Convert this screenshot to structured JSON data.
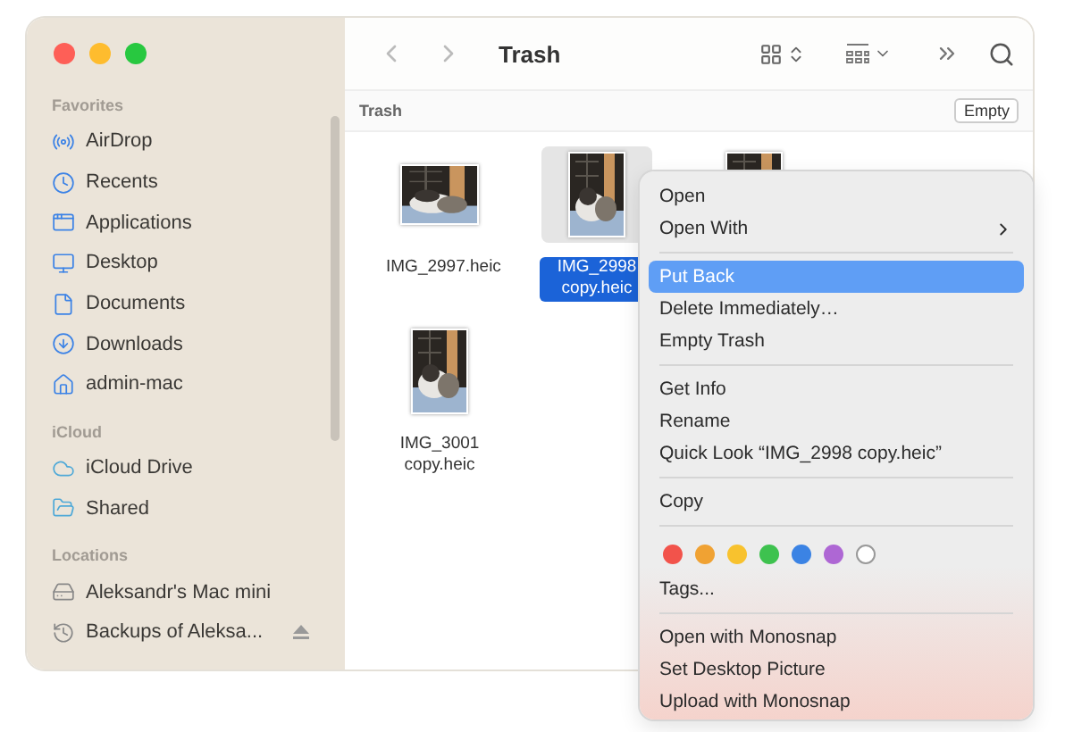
{
  "window": {
    "title": "Trash",
    "controls": [
      {
        "color": "#fe5f57"
      },
      {
        "color": "#febc2e"
      },
      {
        "color": "#28c840"
      }
    ]
  },
  "sidebar": {
    "sections": [
      {
        "heading": "Favorites",
        "items": [
          {
            "label": "AirDrop"
          },
          {
            "label": "Recents"
          },
          {
            "label": "Applications"
          },
          {
            "label": "Desktop"
          },
          {
            "label": "Documents"
          },
          {
            "label": "Downloads"
          },
          {
            "label": "admin-mac"
          }
        ]
      },
      {
        "heading": "iCloud",
        "items": [
          {
            "label": "iCloud Drive"
          },
          {
            "label": "Shared"
          }
        ]
      },
      {
        "heading": "Locations",
        "items": [
          {
            "label": "Aleksandr's Mac mini"
          },
          {
            "label": "Backups of Aleksa...",
            "eject": true
          }
        ]
      }
    ]
  },
  "path_bar": {
    "label": "Trash",
    "button": "Empty"
  },
  "files": [
    {
      "name": "IMG_2997.heic",
      "selected": false,
      "kind": "landscape"
    },
    {
      "name": "IMG_2998 copy.heic",
      "selected": true,
      "kind": "portrait"
    },
    {
      "selected": false,
      "kind": "portrait"
    },
    {
      "name": "IMG_3001 copy.heic",
      "selected": false,
      "kind": "portrait"
    }
  ],
  "context_menu": {
    "items": [
      {
        "kind": "item",
        "label": "Open",
        "selected": false
      },
      {
        "kind": "item",
        "label": "Open With",
        "selected": false,
        "submenu": true
      },
      {
        "kind": "separator"
      },
      {
        "kind": "item",
        "label": "Put Back",
        "selected": true
      },
      {
        "kind": "item",
        "label": "Delete Immediately…",
        "selected": false
      },
      {
        "kind": "item",
        "label": "Empty Trash",
        "selected": false
      },
      {
        "kind": "separator"
      },
      {
        "kind": "item",
        "label": "Get Info",
        "selected": false
      },
      {
        "kind": "item",
        "label": "Rename",
        "selected": false
      },
      {
        "kind": "item",
        "label": "Quick Look “IMG_2998 copy.heic”",
        "selected": false
      },
      {
        "kind": "separator"
      },
      {
        "kind": "item",
        "label": "Copy",
        "selected": false
      },
      {
        "kind": "separator"
      },
      {
        "kind": "tags",
        "colors": [
          {
            "color": "#f2534b"
          },
          {
            "color": "#f0a233"
          },
          {
            "color": "#f8c22e"
          },
          {
            "color": "#3ec24f"
          },
          {
            "color": "#3b83e4"
          },
          {
            "color": "#ae67d4"
          },
          {
            "color": "#ffffff"
          }
        ]
      },
      {
        "kind": "item",
        "label": "Tags...",
        "selected": false
      },
      {
        "kind": "separator"
      },
      {
        "kind": "item",
        "label": "Open with Monosnap",
        "selected": false
      },
      {
        "kind": "item",
        "label": "Set Desktop Picture",
        "selected": false
      },
      {
        "kind": "item",
        "label": "Upload with Monosnap",
        "selected": false
      }
    ]
  }
}
